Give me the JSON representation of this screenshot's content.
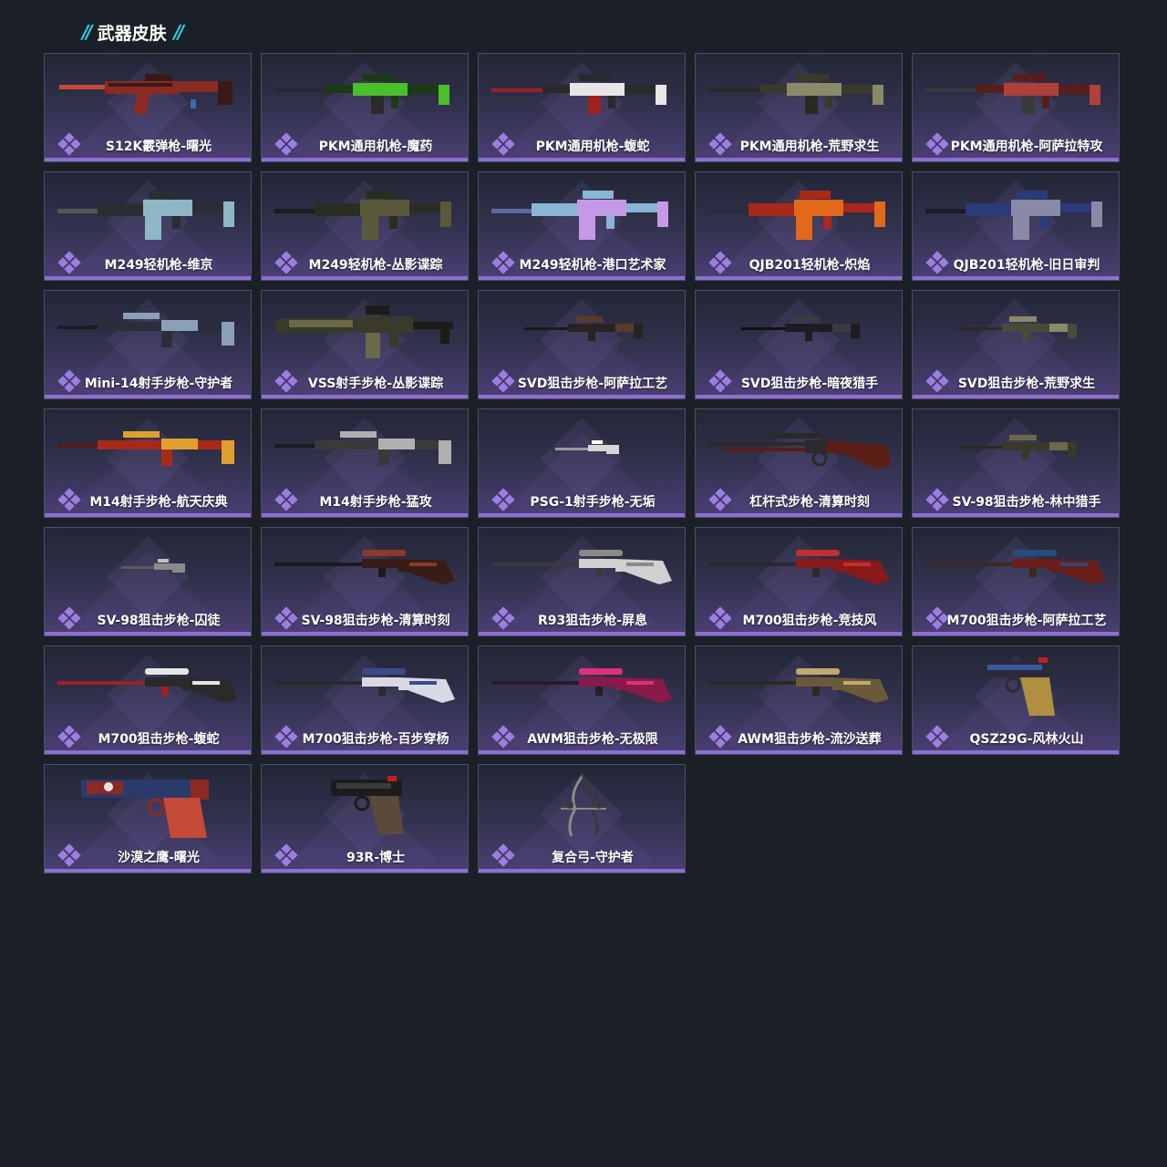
{
  "section": {
    "title": "武器皮肤",
    "accent_color": "#2ed0e6",
    "rarity_color": "#8f6ed4"
  },
  "items": [
    {
      "name": "S12K霰弹枪-曙光",
      "kind": "shotgun",
      "colors": [
        "#8a2a22",
        "#3a1a18",
        "#c24a36"
      ]
    },
    {
      "name": "PKM通用机枪-魔药",
      "kind": "mg",
      "colors": [
        "#1c3a16",
        "#4bbf2a",
        "#2a2a2a"
      ]
    },
    {
      "name": "PKM通用机枪-蝮蛇",
      "kind": "mg",
      "colors": [
        "#2a2a2a",
        "#e6e6e6",
        "#a02020"
      ]
    },
    {
      "name": "PKM通用机枪-荒野求生",
      "kind": "mg",
      "colors": [
        "#3a3a2c",
        "#8a8a6a",
        "#2a2a22"
      ]
    },
    {
      "name": "PKM通用机枪-阿萨拉特攻",
      "kind": "mg",
      "colors": [
        "#5a1e1a",
        "#b0403a",
        "#3a3a3a"
      ]
    },
    {
      "name": "M249轻机枪-维京",
      "kind": "lmg",
      "colors": [
        "#2a2e32",
        "#8fb6c4",
        "#555555"
      ]
    },
    {
      "name": "M249轻机枪-丛影谍踪",
      "kind": "lmg",
      "colors": [
        "#2a2e22",
        "#5a5a3a",
        "#1c1c1c"
      ]
    },
    {
      "name": "M249轻机枪-港口艺术家",
      "kind": "lmg",
      "colors": [
        "#8ab6d6",
        "#c49ae6",
        "#5a6a9a"
      ]
    },
    {
      "name": "QJB201轻机枪-炽焰",
      "kind": "lmg",
      "colors": [
        "#a8281a",
        "#e06a1a",
        "#2a2a40"
      ]
    },
    {
      "name": "QJB201轻机枪-旧日审判",
      "kind": "lmg",
      "colors": [
        "#2a3a7a",
        "#8a8aa8",
        "#1a1a2a"
      ]
    },
    {
      "name": "Mini-14射手步枪-守护者",
      "kind": "dmr",
      "colors": [
        "#2a2e3a",
        "#8aa0b8",
        "#1c1c22"
      ]
    },
    {
      "name": "VSS射手步枪-丛影谍踪",
      "kind": "vss",
      "colors": [
        "#3a3a2a",
        "#6a6a4a",
        "#1c1c16"
      ]
    },
    {
      "name": "SVD狙击步枪-阿萨拉工艺",
      "kind": "sniper-small",
      "colors": [
        "#2a2222",
        "#5a3a2a",
        "#1a1a1a"
      ]
    },
    {
      "name": "SVD狙击步枪-暗夜猎手",
      "kind": "sniper-small",
      "colors": [
        "#1c1c22",
        "#3a3a44",
        "#111111"
      ]
    },
    {
      "name": "SVD狙击步枪-荒野求生",
      "kind": "sniper-small",
      "colors": [
        "#4a4a3a",
        "#8a8a6a",
        "#2a2a22"
      ]
    },
    {
      "name": "M14射手步枪-航天庆典",
      "kind": "dmr",
      "colors": [
        "#a82a1a",
        "#e0a030",
        "#5a1a12"
      ]
    },
    {
      "name": "M14射手步枪-猛攻",
      "kind": "dmr",
      "colors": [
        "#3a3a3a",
        "#b0b0b0",
        "#1c1c1c"
      ]
    },
    {
      "name": "PSG-1射手步枪-无垢",
      "kind": "tiny",
      "colors": [
        "#d6d6d6",
        "#9a9a9a",
        "#ffffff"
      ]
    },
    {
      "name": "杠杆式步枪-清算时刻",
      "kind": "lever",
      "colors": [
        "#5a1e16",
        "#2a2a2a",
        "#8a3a22"
      ]
    },
    {
      "name": "SV-98狙击步枪-林中猎手",
      "kind": "sniper-small",
      "colors": [
        "#3a3a2a",
        "#6a6a4a",
        "#2a2a1a"
      ]
    },
    {
      "name": "SV-98狙击步枪-囚徒",
      "kind": "tiny",
      "colors": [
        "#8a8a8a",
        "#5a5a5a",
        "#c0c0c0"
      ]
    },
    {
      "name": "SV-98狙击步枪-清算时刻",
      "kind": "sniper",
      "colors": [
        "#3a1c16",
        "#8a3a2a",
        "#1a1a1a"
      ]
    },
    {
      "name": "R93狙击步枪-屏息",
      "kind": "sniper",
      "colors": [
        "#d0d0d0",
        "#8a8a8a",
        "#3a3a3a"
      ]
    },
    {
      "name": "M700狙击步枪-竞技风",
      "kind": "sniper",
      "colors": [
        "#8a1a1a",
        "#c03030",
        "#2a2a2a"
      ]
    },
    {
      "name": "M700狙击步枪-阿萨拉工艺",
      "kind": "sniper",
      "colors": [
        "#6a1e1a",
        "#2a4a7a",
        "#3a2a22"
      ]
    },
    {
      "name": "M700狙击步枪-蝮蛇",
      "kind": "sniper",
      "colors": [
        "#2a2a2a",
        "#e6e6e6",
        "#a02020"
      ]
    },
    {
      "name": "M700狙击步枪-百步穿杨",
      "kind": "sniper",
      "colors": [
        "#d8d8e6",
        "#3a4a8a",
        "#2a2a2a"
      ]
    },
    {
      "name": "AWM狙击步枪-无极限",
      "kind": "sniper",
      "colors": [
        "#8a1a4a",
        "#e0307a",
        "#2a1a2a"
      ]
    },
    {
      "name": "AWM狙击步枪-流沙送葬",
      "kind": "sniper",
      "colors": [
        "#6a5a3a",
        "#c0a870",
        "#2a2a22"
      ]
    },
    {
      "name": "QSZ29G-风林火山",
      "kind": "pistol",
      "colors": [
        "#2a2a3a",
        "#3a5aa0",
        "#b09040"
      ]
    },
    {
      "name": "沙漠之鹰-曙光",
      "kind": "deagle",
      "colors": [
        "#8a2a22",
        "#2a3a6a",
        "#c24a36"
      ]
    },
    {
      "name": "93R-博士",
      "kind": "pistol",
      "colors": [
        "#1c1c1c",
        "#3a3a3a",
        "#5a4a3a"
      ]
    },
    {
      "name": "复合弓-守护者",
      "kind": "bow",
      "colors": [
        "#3a3a3a",
        "#8a8a8a",
        "#1c1c1c"
      ]
    }
  ]
}
